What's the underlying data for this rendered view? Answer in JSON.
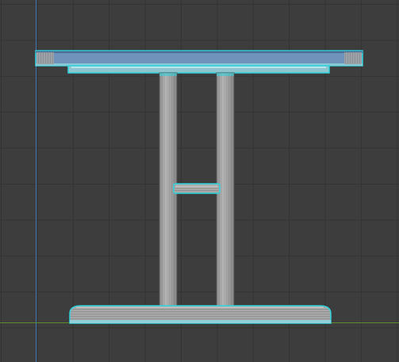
{
  "viewport": {
    "name": "3D Viewport",
    "shading": "solid-wireframe",
    "grid_visible": true
  },
  "scene": {
    "object": "table",
    "parts": [
      "table-top",
      "apron",
      "left-leg",
      "right-leg",
      "stretcher",
      "base"
    ]
  },
  "colors": {
    "background": "#3d3d3d",
    "grid_line": "#333333",
    "axis_z": "#3f78b4",
    "axis_y": "#5d8a2a",
    "selection": "#2fd4e0",
    "table_top_face": "#6a8fb7",
    "mesh_gray": "#a9a9a9"
  }
}
